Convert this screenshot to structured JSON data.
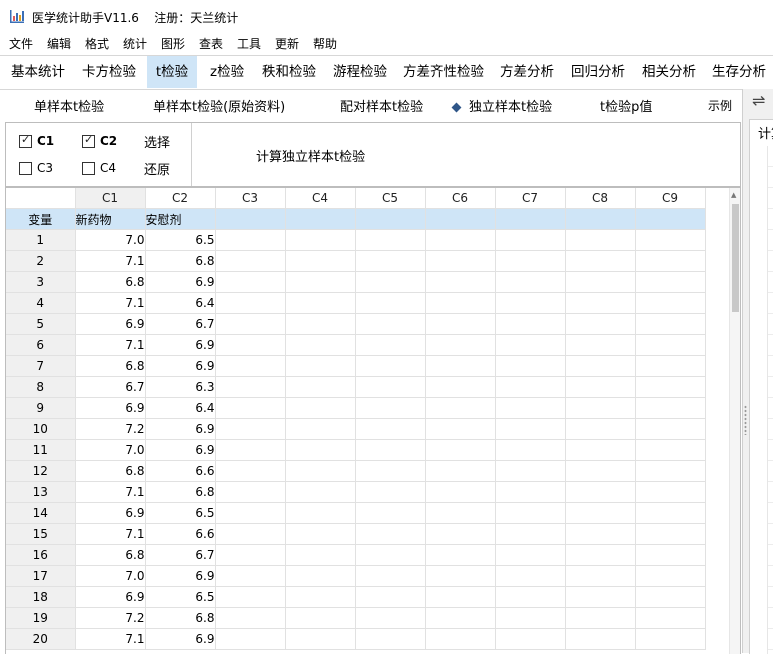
{
  "window": {
    "title": "医学统计助手V11.6",
    "registration": "注册：天兰统计"
  },
  "menu": [
    "文件",
    "编辑",
    "格式",
    "统计",
    "图形",
    "查表",
    "工具",
    "更新",
    "帮助"
  ],
  "tabs": [
    "基本统计",
    "卡方检验",
    "t检验",
    "z检验",
    "秩和检验",
    "游程检验",
    "方差齐性检验",
    "方差分析",
    "回归分析",
    "相关分析",
    "生存分析"
  ],
  "active_tab": "t检验",
  "subtabs": [
    "单样本t检验",
    "单样本t检验(原始资料)",
    "配对样本t检验",
    "独立样本t检验",
    "t检验p值",
    "示例"
  ],
  "active_subtab": "独立样本t检验",
  "options": {
    "checkboxes": [
      {
        "label": "C1",
        "checked": true
      },
      {
        "label": "C2",
        "checked": true
      },
      {
        "label": "C3",
        "checked": false
      },
      {
        "label": "C4",
        "checked": false
      }
    ],
    "select_label": "选择",
    "restore_label": "还原",
    "calc_label": "计算独立样本t检验"
  },
  "right_panel": {
    "label": "计算"
  },
  "grid": {
    "columns": [
      "C1",
      "C2",
      "C3",
      "C4",
      "C5",
      "C6",
      "C7",
      "C8",
      "C9"
    ],
    "var_label": "变量",
    "var_names": [
      "新药物",
      "安慰剂"
    ],
    "rows": [
      {
        "n": "1",
        "c1": "7.0",
        "c2": "6.5"
      },
      {
        "n": "2",
        "c1": "7.1",
        "c2": "6.8"
      },
      {
        "n": "3",
        "c1": "6.8",
        "c2": "6.9"
      },
      {
        "n": "4",
        "c1": "7.1",
        "c2": "6.4"
      },
      {
        "n": "5",
        "c1": "6.9",
        "c2": "6.7"
      },
      {
        "n": "6",
        "c1": "7.1",
        "c2": "6.9"
      },
      {
        "n": "7",
        "c1": "6.8",
        "c2": "6.9"
      },
      {
        "n": "8",
        "c1": "6.7",
        "c2": "6.3"
      },
      {
        "n": "9",
        "c1": "6.9",
        "c2": "6.4"
      },
      {
        "n": "10",
        "c1": "7.2",
        "c2": "6.9"
      },
      {
        "n": "11",
        "c1": "7.0",
        "c2": "6.9"
      },
      {
        "n": "12",
        "c1": "6.8",
        "c2": "6.6"
      },
      {
        "n": "13",
        "c1": "7.1",
        "c2": "6.8"
      },
      {
        "n": "14",
        "c1": "6.9",
        "c2": "6.5"
      },
      {
        "n": "15",
        "c1": "7.1",
        "c2": "6.6"
      },
      {
        "n": "16",
        "c1": "6.8",
        "c2": "6.7"
      },
      {
        "n": "17",
        "c1": "7.0",
        "c2": "6.9"
      },
      {
        "n": "18",
        "c1": "6.9",
        "c2": "6.5"
      },
      {
        "n": "19",
        "c1": "7.2",
        "c2": "6.8"
      },
      {
        "n": "20",
        "c1": "7.1",
        "c2": "6.9"
      }
    ]
  },
  "colors": {
    "accent": "#cfe5f7",
    "icon_blue": "#2f5688"
  },
  "icons": {
    "app": "chart-bar-icon",
    "swap": "swap-icon"
  }
}
